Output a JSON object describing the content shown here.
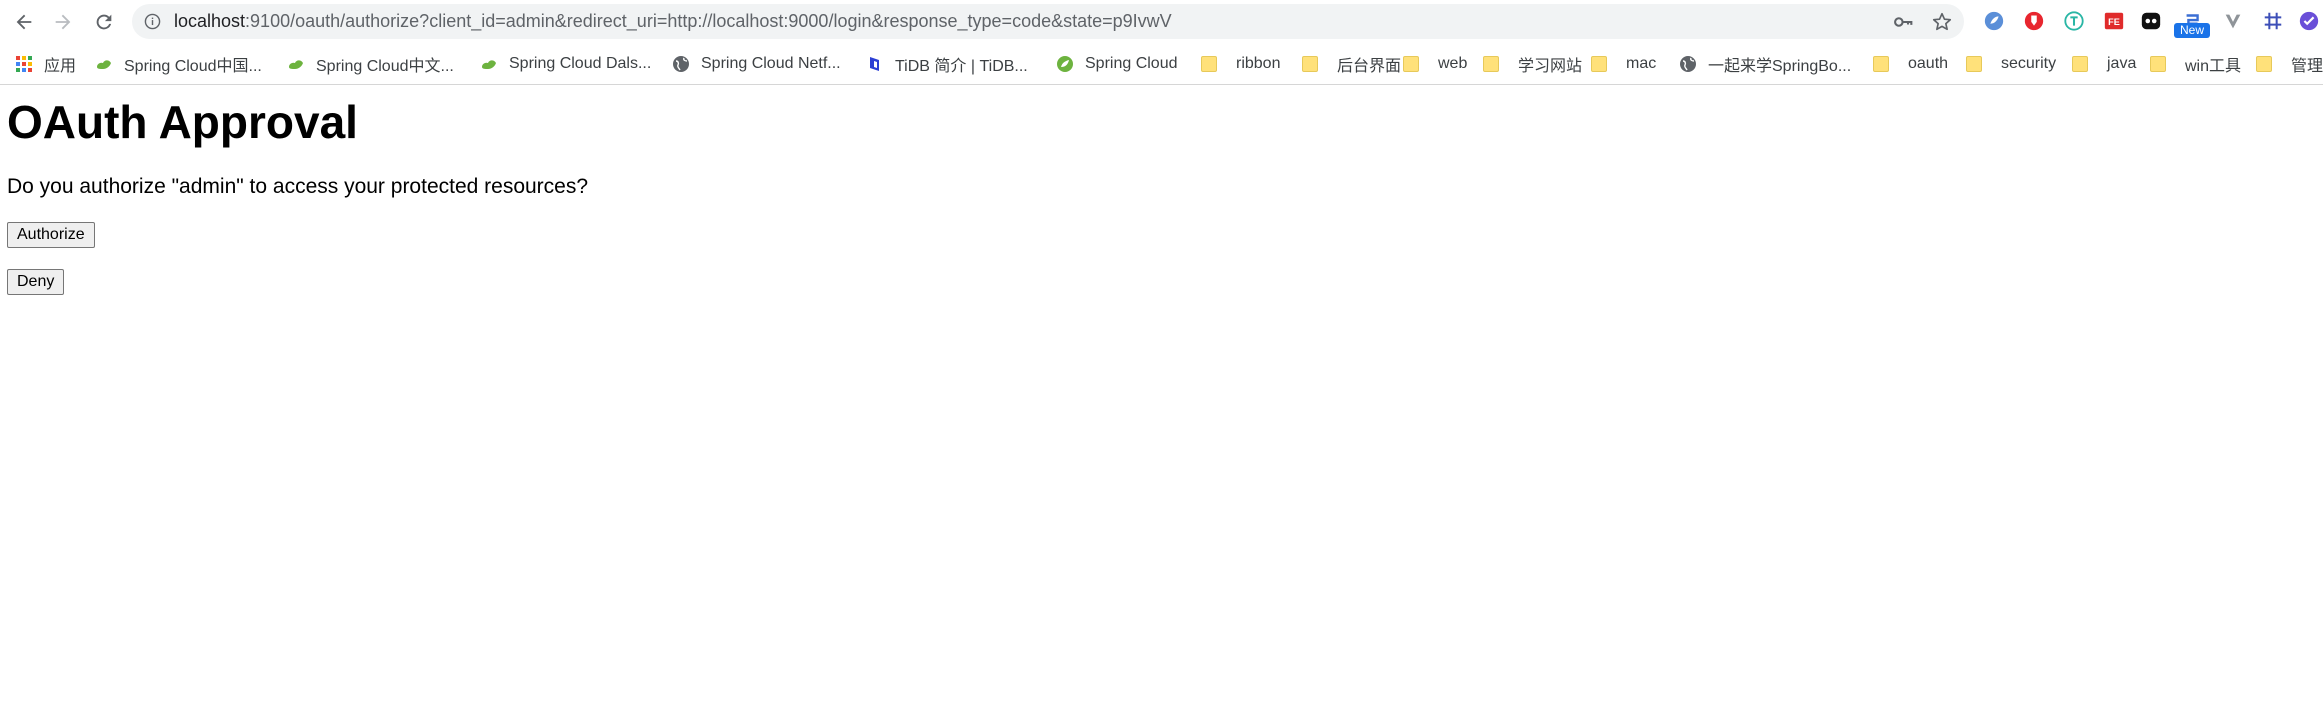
{
  "browser": {
    "url_host": "localhost",
    "url_rest": ":9100/oauth/authorize?client_id=admin&redirect_uri=http://localhost:9000/login&response_type=code&state=p9IvwV",
    "extension_badge": "New"
  },
  "bookmarks": [
    {
      "label": "应用",
      "icon": "apps-icon"
    },
    {
      "label": "Spring Cloud中国...",
      "icon": "cloud-leaf-icon"
    },
    {
      "label": "Spring Cloud中文...",
      "icon": "cloud-leaf-icon"
    },
    {
      "label": "Spring Cloud Dals...",
      "icon": "cloud-leaf-icon"
    },
    {
      "label": "Spring Cloud Netf...",
      "icon": "globe-icon"
    },
    {
      "label": "TiDB 简介 | TiDB...",
      "icon": "tidb-icon"
    },
    {
      "label": "Spring Cloud",
      "icon": "spring-icon"
    },
    {
      "label": "ribbon",
      "icon": "folder-icon"
    },
    {
      "label": "后台界面",
      "icon": "folder-icon"
    },
    {
      "label": "web",
      "icon": "folder-icon"
    },
    {
      "label": "学习网站",
      "icon": "folder-icon"
    },
    {
      "label": "mac",
      "icon": "folder-icon"
    },
    {
      "label": "一起来学SpringBo...",
      "icon": "globe-icon"
    },
    {
      "label": "oauth",
      "icon": "folder-icon"
    },
    {
      "label": "security",
      "icon": "folder-icon"
    },
    {
      "label": "java",
      "icon": "folder-icon"
    },
    {
      "label": "win工具",
      "icon": "folder-icon"
    },
    {
      "label": "管理",
      "icon": "folder-icon"
    }
  ],
  "page": {
    "title": "OAuth Approval",
    "question": "Do you authorize \"admin\" to access your protected resources?",
    "authorize_label": "Authorize",
    "deny_label": "Deny"
  }
}
